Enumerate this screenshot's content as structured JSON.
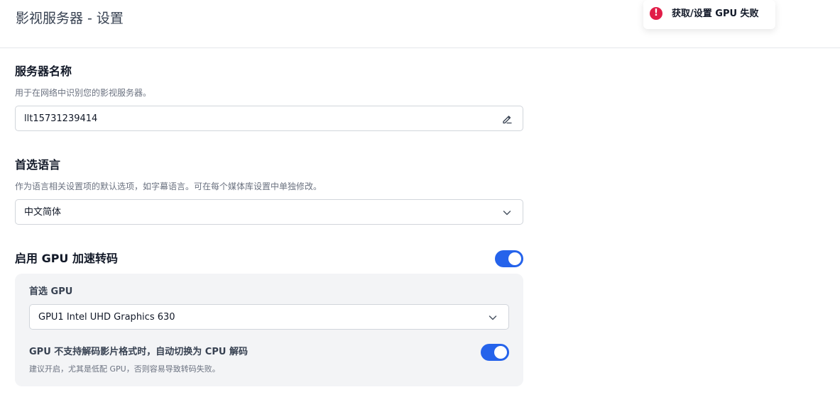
{
  "header": {
    "title": "影视服务器 - 设置"
  },
  "toast": {
    "icon": "error-icon",
    "icon_glyph": "!",
    "message": "获取/设置 GPU 失败",
    "color": "#e11d48"
  },
  "server_name": {
    "title": "服务器名称",
    "description": "用于在网络中识别您的影视服务器。",
    "value": "llt15731239414",
    "icon": "edit-pencil-icon"
  },
  "language": {
    "title": "首选语言",
    "description": "作为语言相关设置项的默认选项，如字幕语言。可在每个媒体库设置中单独修改。",
    "selected": "中文简体",
    "icon": "chevron-down-icon"
  },
  "gpu_accel": {
    "title": "启用 GPU 加速转码",
    "enabled": true,
    "accent": "#2563eb",
    "preferred_gpu": {
      "label": "首选 GPU",
      "selected": "GPU1 Intel UHD Graphics 630",
      "icon": "chevron-down-icon"
    },
    "cpu_fallback": {
      "label": "GPU 不支持解码影片格式时，自动切换为 CPU 解码",
      "description": "建议开启，尤其是低配 GPU，否则容易导致转码失败。",
      "enabled": true
    }
  }
}
